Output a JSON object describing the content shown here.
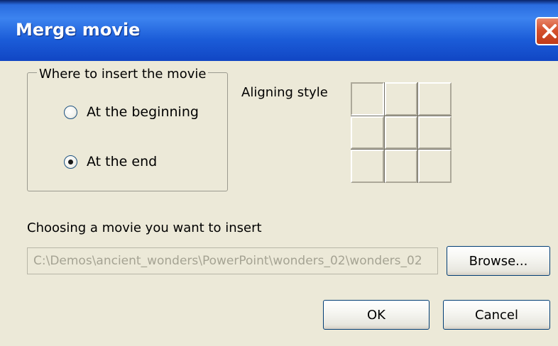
{
  "window": {
    "title": "Merge movie"
  },
  "insert_group": {
    "legend": "Where to insert the movie",
    "options": [
      {
        "label": "At the beginning",
        "selected": false
      },
      {
        "label": "At the end",
        "selected": true
      }
    ]
  },
  "align": {
    "label": "Aligning style",
    "selected_cell": "top-left"
  },
  "movie": {
    "label": "Choosing a movie you want to insert",
    "path_value": "C:\\Demos\\ancient_wonders\\PowerPoint\\wonders_02\\wonders_02",
    "browse_label": "Browse..."
  },
  "buttons": {
    "ok_label": "OK",
    "cancel_label": "Cancel"
  },
  "colors": {
    "titlebar": "#2a6ce0",
    "dialog_bg": "#ece9d8",
    "close_button": "#d4512e"
  }
}
